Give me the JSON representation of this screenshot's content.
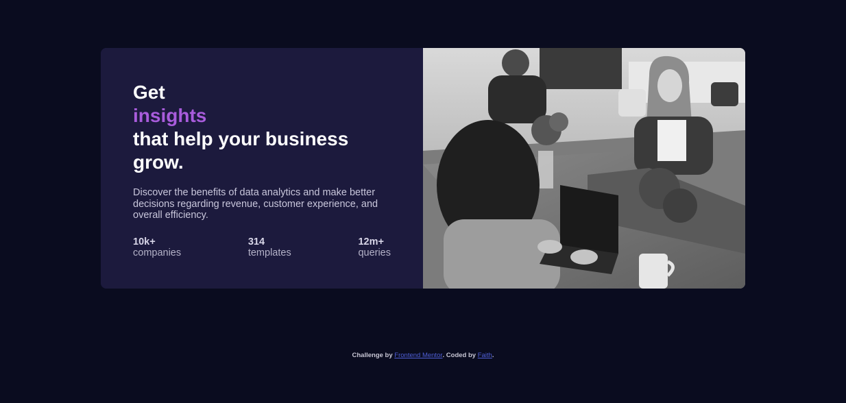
{
  "card": {
    "headline": {
      "line1": "Get",
      "accent": "insights",
      "line3": "that help your business",
      "line4": "grow."
    },
    "description": "Discover the benefits of data analytics and make better decisions regarding revenue, customer experience, and overall efficiency.",
    "stats": [
      {
        "value": "10k+",
        "label": "companies"
      },
      {
        "value": "314",
        "label": "templates"
      },
      {
        "value": "12m+",
        "label": "queries"
      }
    ],
    "image": {
      "description": "grayscale photo of people working at laptops in an office"
    }
  },
  "footer": {
    "prefix": "Challenge by ",
    "link1": "Frontend Mentor",
    "middle": ". Coded by ",
    "link2": "Faith",
    "suffix": "."
  },
  "colors": {
    "background": "#0a0c1f",
    "card": "#1c1a3d",
    "accent": "#a95cdc",
    "link": "#4f5fd6"
  }
}
